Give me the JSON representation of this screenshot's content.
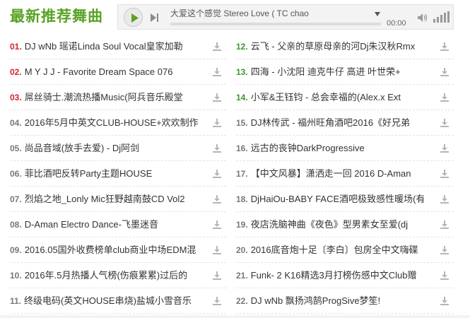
{
  "section": {
    "title": "最新推荐舞曲"
  },
  "player": {
    "song_title": "大爱这个感觉 Stereo Love ( TC chao",
    "time": "00:00",
    "progress": 0,
    "accent_color": "#58a324"
  },
  "icons": {
    "play": "play-icon",
    "next": "next-icon",
    "dropdown": "chevron-down-icon",
    "volume": "volume-icon",
    "volume_level": "volume-bars-icon",
    "download": "download-icon"
  },
  "songs_left": [
    {
      "num": "01.",
      "title": "DJ wNb 瑶诺Linda Soul Vocal皇家加勒",
      "rank_color": "red"
    },
    {
      "num": "02.",
      "title": "M Y J J - Favorite Dream Space 076",
      "rank_color": "red"
    },
    {
      "num": "03.",
      "title": "屌丝骑士.潮流热播Music(阿兵音乐殿堂",
      "rank_color": "red"
    },
    {
      "num": "04.",
      "title": "2016年5月中英文CLUB-HOUSE+欢欢制作",
      "rank_color": "gray"
    },
    {
      "num": "05.",
      "title": "尚品音域(放手去爱) - Dj阿剑",
      "rank_color": "gray"
    },
    {
      "num": "06.",
      "title": "菲比酒吧反转Party主题HOUSE",
      "rank_color": "gray"
    },
    {
      "num": "07.",
      "title": "烈焰之地_Lonly Mic狂野越南鼓CD Vol2",
      "rank_color": "gray"
    },
    {
      "num": "08.",
      "title": "D-Aman Electro Dance-飞墨迷音",
      "rank_color": "gray"
    },
    {
      "num": "09.",
      "title": "2016.05国外收费榜单club商业中场EDM混",
      "rank_color": "gray"
    },
    {
      "num": "10.",
      "title": "2016年.5月热播人气榜(伤痕累累)过后的",
      "rank_color": "gray"
    },
    {
      "num": "11.",
      "title": "终级电码(英文HOUSE串烧)盐城小雪音乐",
      "rank_color": "gray"
    }
  ],
  "songs_right": [
    {
      "num": "12.",
      "title": "云飞 - 父亲的草原母亲的河Dj朱汉秋Rmx",
      "rank_color": "green"
    },
    {
      "num": "13.",
      "title": "四海 - 小沈阳 迪克牛仔 高进 叶世荣+",
      "rank_color": "green"
    },
    {
      "num": "14.",
      "title": "小军&王钰钧 - 总会幸福的(Alex.x Ext",
      "rank_color": "green"
    },
    {
      "num": "15.",
      "title": "DJ林传武 - 福州旺角酒吧2016《好兄弟",
      "rank_color": "gray"
    },
    {
      "num": "16.",
      "title": "远古的丧钟DarkProgressive",
      "rank_color": "gray"
    },
    {
      "num": "17.",
      "title": "【中文风暴】潇洒走一回 2016 D-Aman",
      "rank_color": "gray"
    },
    {
      "num": "18.",
      "title": "DjHaiOu-BABY FACE酒吧极致感性暖场(有",
      "rank_color": "gray"
    },
    {
      "num": "19.",
      "title": "夜店洗脑神曲《夜色》型男素女至爱(dj",
      "rank_color": "gray"
    },
    {
      "num": "20.",
      "title": "2016底音炮十足〔李白〕包房全中文嗨碟",
      "rank_color": "gray"
    },
    {
      "num": "21.",
      "title": "Funk- 2 K16精选3月打榜伤感中文Club赠",
      "rank_color": "gray"
    },
    {
      "num": "22.",
      "title": "DJ wNb 飘扬鸿鹄ProgSive梦笙!",
      "rank_color": "gray"
    }
  ]
}
